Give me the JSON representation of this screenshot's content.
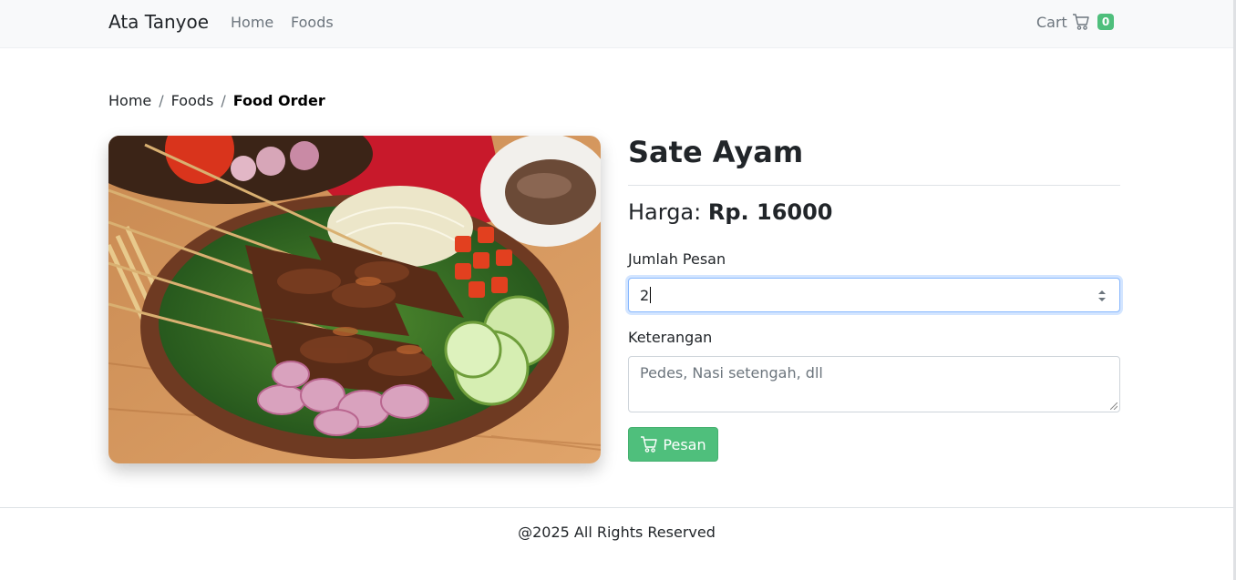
{
  "navbar": {
    "brand": "Ata Tanyoe",
    "links": [
      "Home",
      "Foods"
    ],
    "cart_label": "Cart",
    "cart_count": "0"
  },
  "breadcrumb": {
    "items": [
      "Home",
      "Foods"
    ],
    "separator": "/",
    "active": "Food Order"
  },
  "food": {
    "name": "Sate Ayam",
    "price_label": "Harga:",
    "price_value": "Rp. 16000"
  },
  "form": {
    "qty_label": "Jumlah Pesan",
    "qty_value": "2",
    "note_label": "Keterangan",
    "note_placeholder": "Pedes, Nasi setengah, dll",
    "submit_label": "Pesan"
  },
  "footer": {
    "text": "@2025 All Rights Reserved"
  },
  "icons": {
    "cart": "cart-icon",
    "spinner": "spinner-arrows-icon"
  },
  "colors": {
    "accent": "#4fbf7c",
    "navbar_bg": "#f8f9fa",
    "focus": "#86b7fe"
  }
}
